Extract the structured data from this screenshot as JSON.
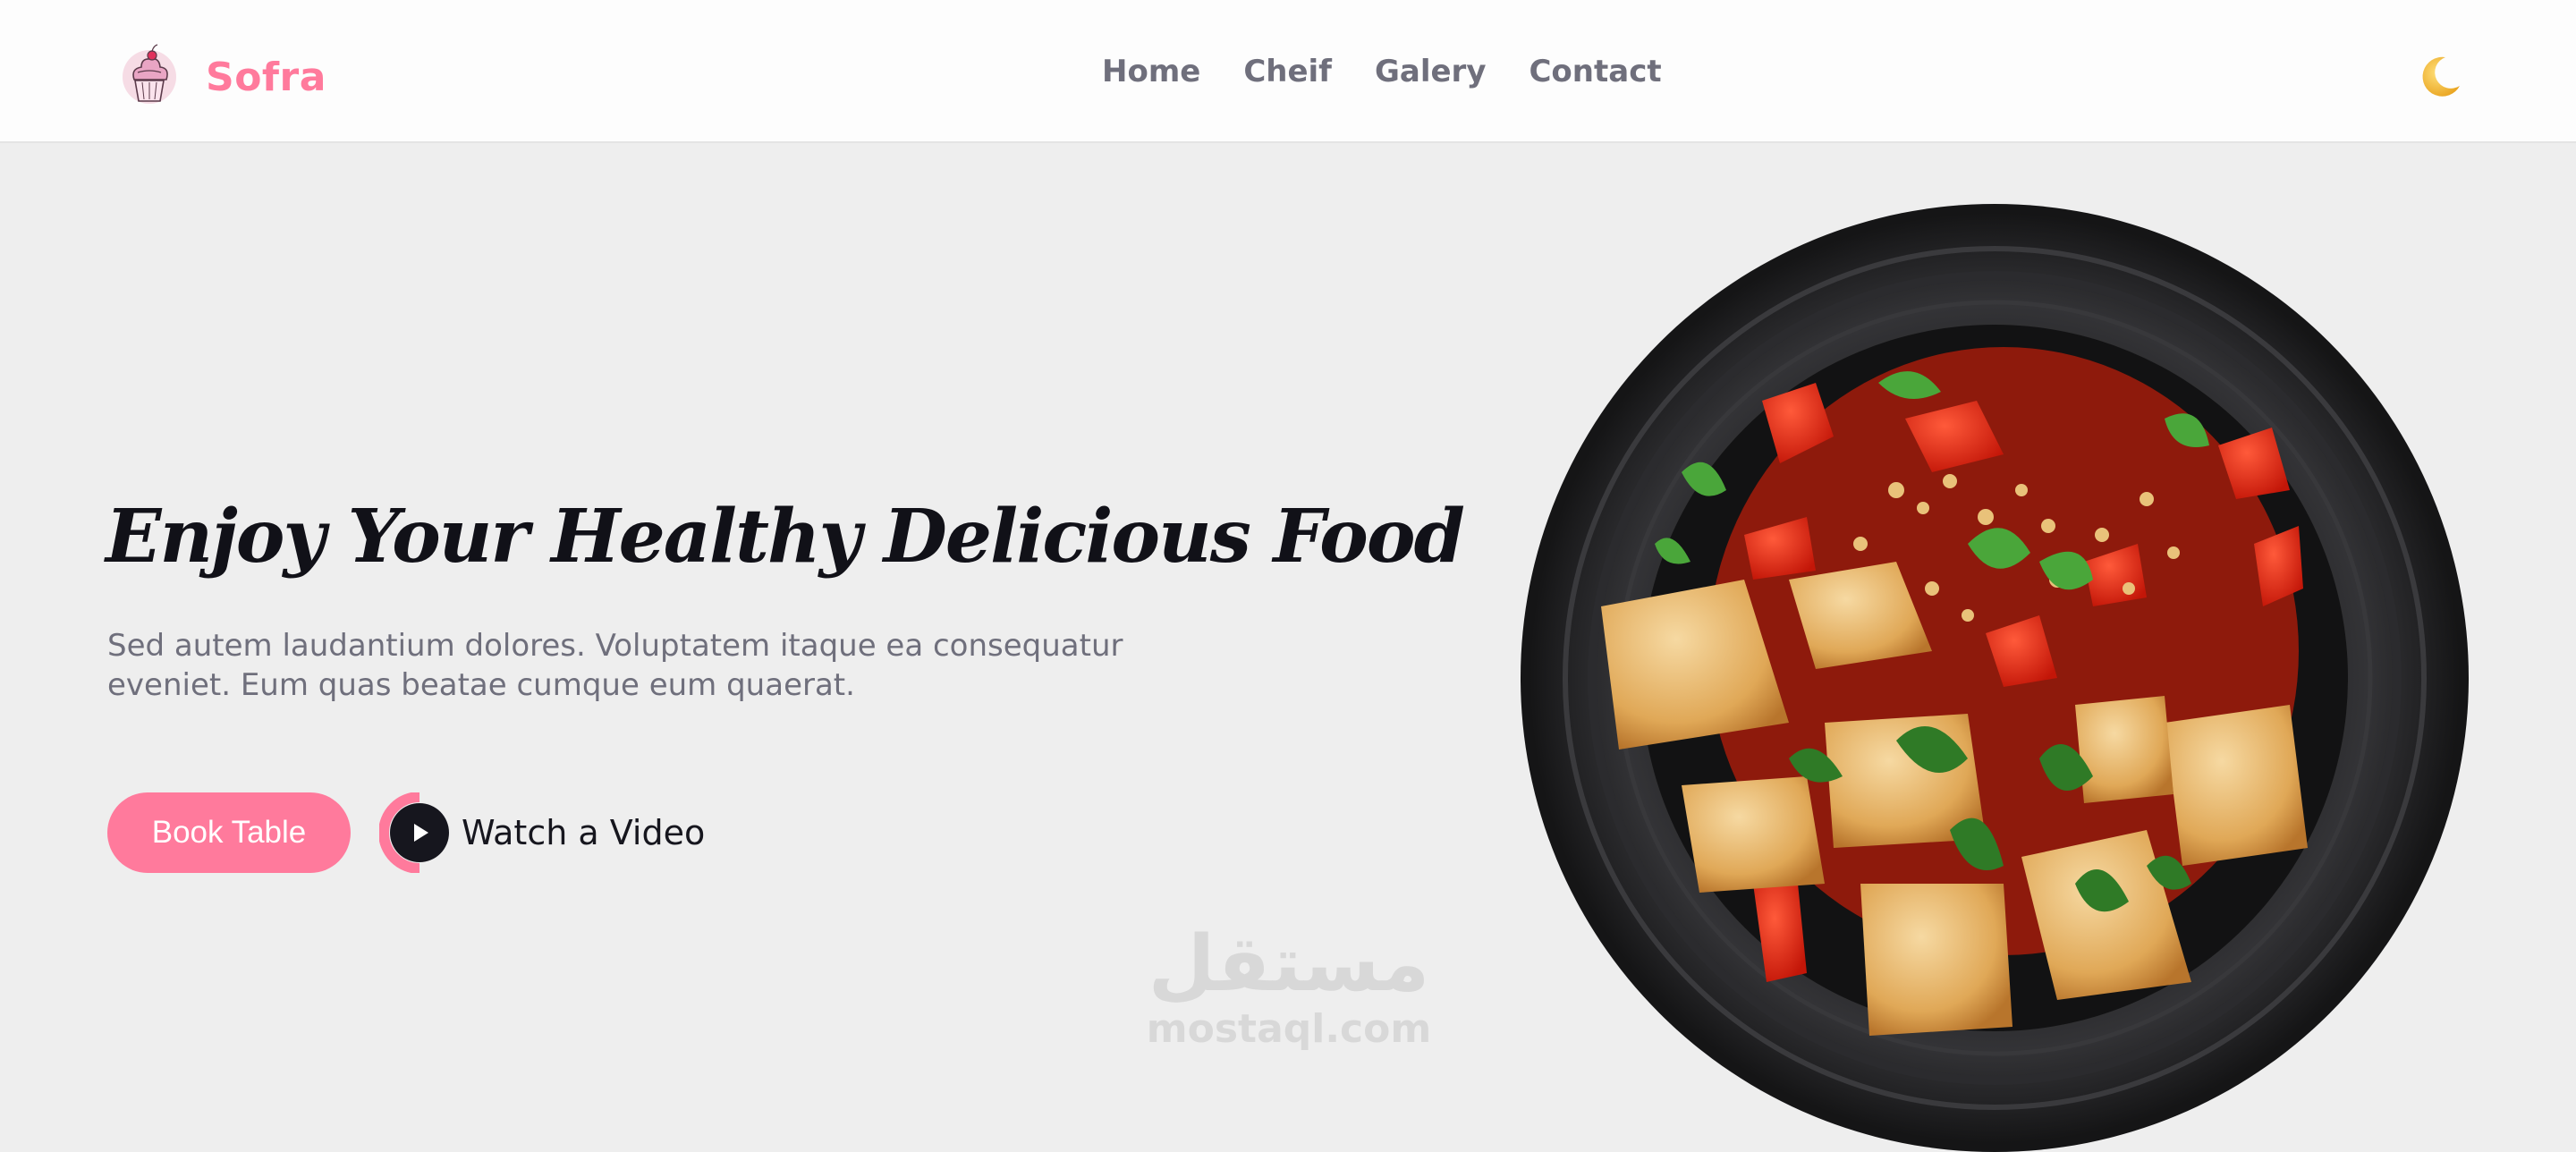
{
  "header": {
    "brand_name": "Sofra",
    "logo_icon": "cupcake-icon",
    "nav": [
      {
        "label": "Home"
      },
      {
        "label": "Cheif"
      },
      {
        "label": "Galery"
      },
      {
        "label": "Contact"
      }
    ],
    "theme_toggle_icon": "moon-icon"
  },
  "hero": {
    "title": "Enjoy Your Healthy Delicious Food",
    "description": "Sed autem laudantium dolores. Voluptatem itaque ea consequatur eveniet. Eum quas beatae cumque eum quaerat.",
    "book_button": "Book Table",
    "watch_label": "Watch a Video",
    "play_icon": "play-icon",
    "image_icon": "food-plate-image"
  },
  "watermark": {
    "arabic": "مستقل",
    "latin": "mostaql.com"
  },
  "colors": {
    "accent": "#ff7a9c",
    "text_dark": "#16161e",
    "text_muted": "#6f6f7c",
    "background": "#eeeeee",
    "header_bg": "#fdfdfd"
  }
}
